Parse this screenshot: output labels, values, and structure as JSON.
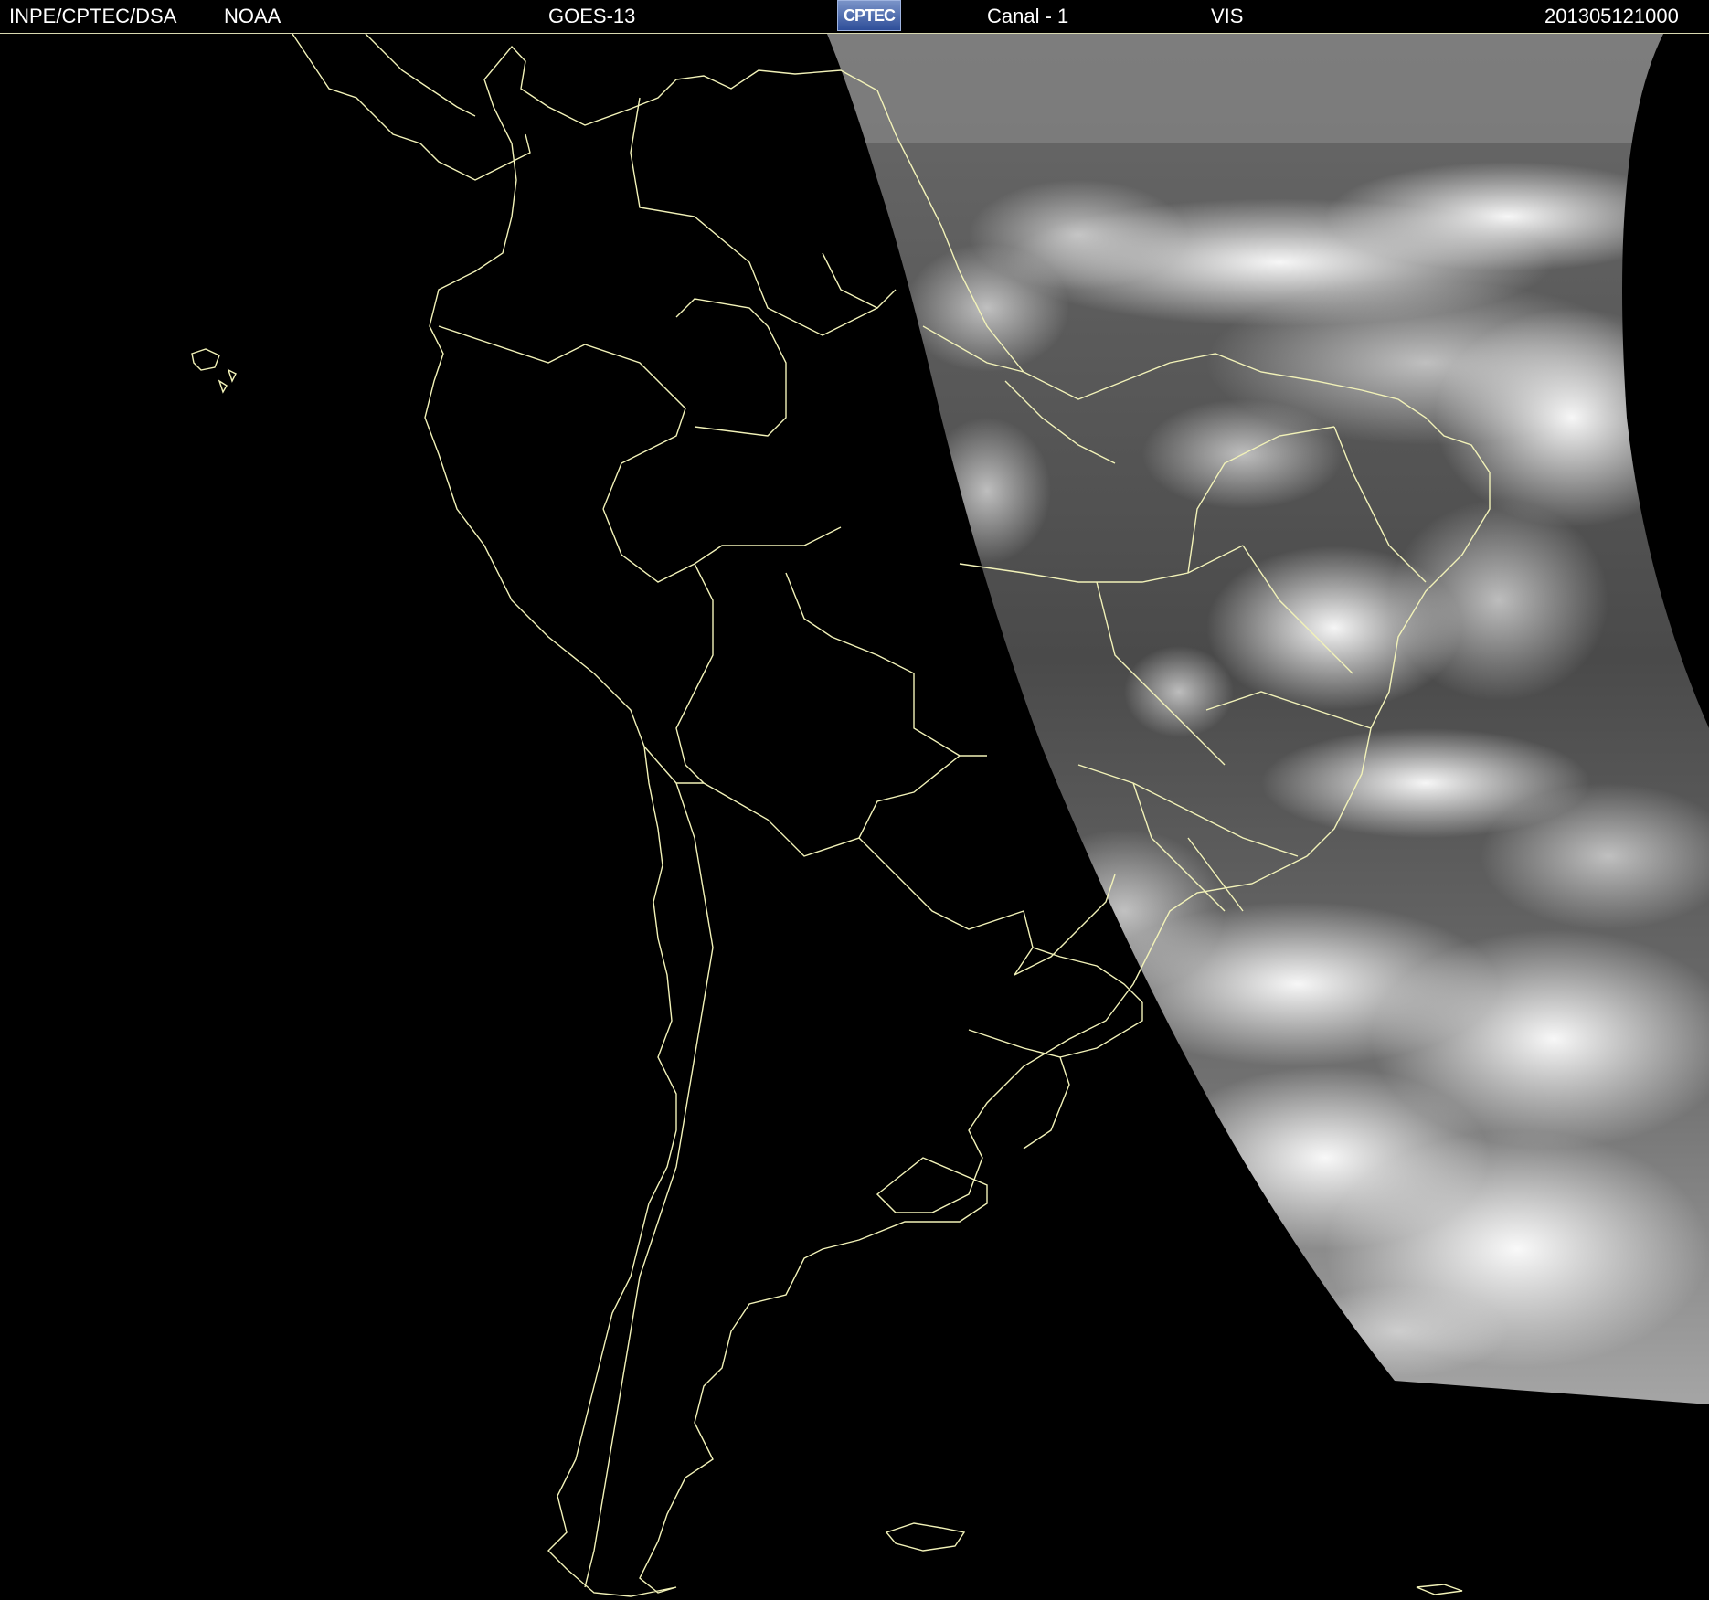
{
  "header": {
    "institution": "INPE/CPTEC/DSA",
    "agency": "NOAA",
    "satellite": "GOES-13",
    "logo_text": "CPTEC",
    "channel": "Canal - 1",
    "band": "VIS",
    "timestamp": "201305121000"
  },
  "colors": {
    "background": "#000000",
    "coastline": "#f2f2b8",
    "header_text": "#ffffff",
    "logo": "#3b5aa8"
  },
  "map": {
    "region": "South America",
    "imagery": "visible satellite cloud imagery (daylight portion on east side)"
  }
}
